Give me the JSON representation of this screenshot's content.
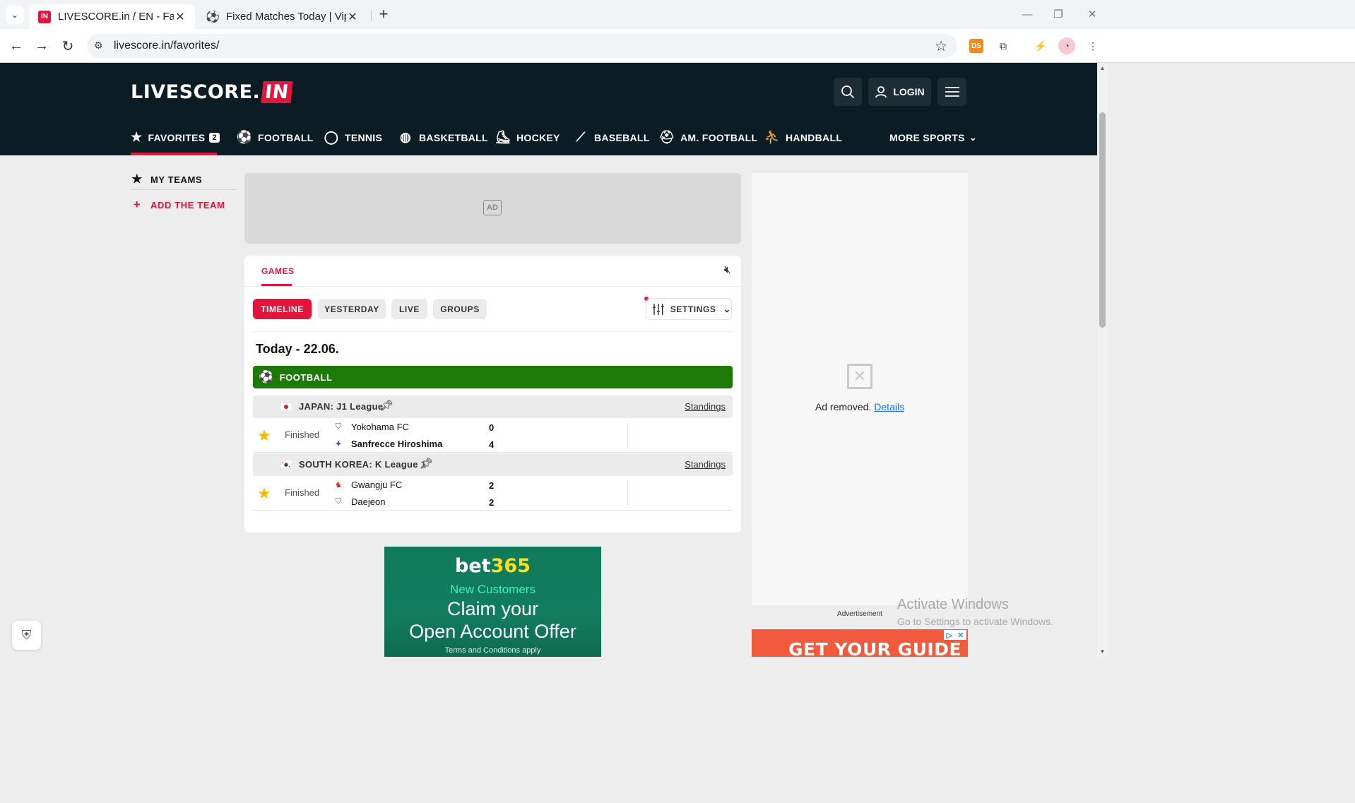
{
  "browser": {
    "tabs": [
      {
        "title": "LIVESCORE.in / EN - Favorites",
        "favicon": "IN",
        "close": "✕"
      },
      {
        "title": "Fixed Matches Today | Vip Fixed",
        "favicon": "⚽",
        "close": "✕"
      }
    ],
    "new_tab": "+",
    "url": "livescore.in/favorites/",
    "ext_ds": "DS"
  },
  "site": {
    "logo_main": "LIVESCORE.",
    "logo_in": "IN",
    "login": "LOGIN",
    "nav": [
      {
        "label": "FAVORITES",
        "count": "2",
        "icon": "star-icon"
      },
      {
        "label": "FOOTBALL",
        "icon": "football-icon"
      },
      {
        "label": "TENNIS",
        "icon": "tennis-icon"
      },
      {
        "label": "BASKETBALL",
        "icon": "basketball-icon"
      },
      {
        "label": "HOCKEY",
        "icon": "hockey-icon"
      },
      {
        "label": "BASEBALL",
        "icon": "baseball-icon"
      },
      {
        "label": "AM. FOOTBALL",
        "icon": "am-football-icon"
      },
      {
        "label": "HANDBALL",
        "icon": "handball-icon"
      }
    ],
    "more_sports": "MORE SPORTS",
    "accent": "#e2153c",
    "header_bg": "#0c1c24"
  },
  "sidebar": {
    "my_teams": "MY TEAMS",
    "add_team": "ADD THE TEAM"
  },
  "main": {
    "ad_label": "AD",
    "tab_games": "GAMES",
    "filters": [
      "TIMELINE",
      "YESTERDAY",
      "LIVE",
      "GROUPS"
    ],
    "settings": "SETTINGS",
    "day_title": "Today - 22.06.",
    "sport_bar": "FOOTBALL",
    "sport_bar_color": "#1d7a07",
    "standings": "Standings",
    "leagues": [
      {
        "name": "JAPAN: J1 League",
        "match": {
          "status": "Finished",
          "home": "Yokohama FC",
          "home_score": "0",
          "away": "Sanfrecce Hiroshima",
          "away_score": "4"
        }
      },
      {
        "name": "SOUTH KOREA: K League 1",
        "match": {
          "status": "Finished",
          "home": "Gwangju FC",
          "home_score": "2",
          "away": "Daejeon",
          "away_score": "2"
        }
      }
    ]
  },
  "bet_ad": {
    "logo_a": "bet",
    "logo_b": "365",
    "new_customers": "New Customers",
    "claim_line1": "Claim your",
    "claim_line2": "Open Account Offer",
    "terms": "Terms and Conditions apply"
  },
  "right": {
    "ad_removed": "Ad removed.",
    "details": "Details",
    "advertisement": "Advertisement",
    "guide_text": "GET YOUR GUIDE"
  },
  "windows": {
    "activate_title": "Activate Windows",
    "activate_sub": "Go to Settings to activate Windows."
  }
}
